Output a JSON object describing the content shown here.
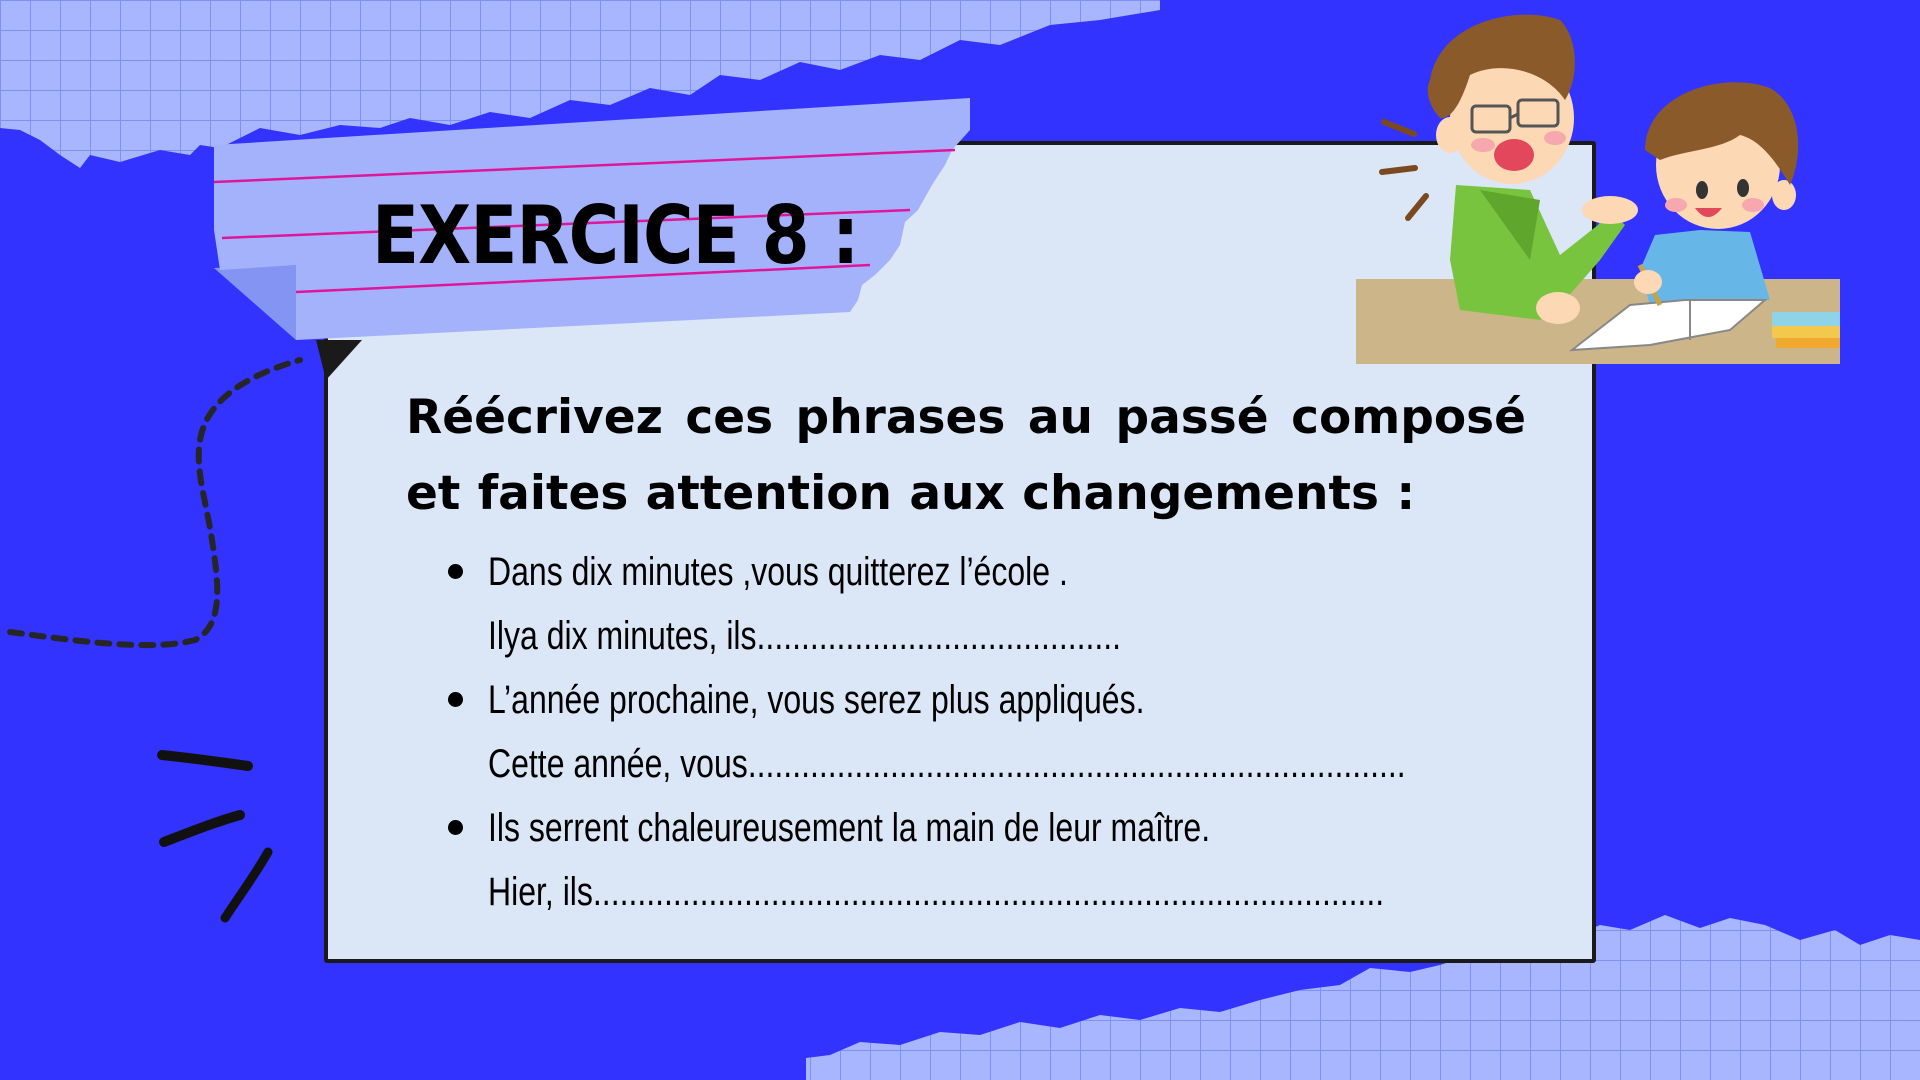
{
  "exercise": {
    "title": "EXERCICE 8 :",
    "instruction": "Réécrivez ces phrases au passé composé et faites attention aux changements :",
    "items": [
      {
        "sentence": "Dans dix minutes ,vous quitterez l’école .",
        "answer": "Ilya dix minutes, ils........................................."
      },
      {
        "sentence": "L’année prochaine, vous serez plus appliqués.",
        "answer": "Cette année, vous.........................................................................."
      },
      {
        "sentence": "Ils serrent chaleureusement la main de leur maître.",
        "answer": "Hier, ils........................................................................................."
      }
    ]
  },
  "colors": {
    "background": "#3333ff",
    "grid_paper": "#a7b6ff",
    "grid_lines": "#7f8ff2",
    "card": "#dbe6f6",
    "tape": "#a3b2fa",
    "tape_lines": "#e0169a"
  },
  "decorations": {
    "illustration": "teacher-and-student-icon",
    "dotted_path": "dotted-swirl-icon",
    "emphasis_marks": "burst-lines-icon"
  }
}
